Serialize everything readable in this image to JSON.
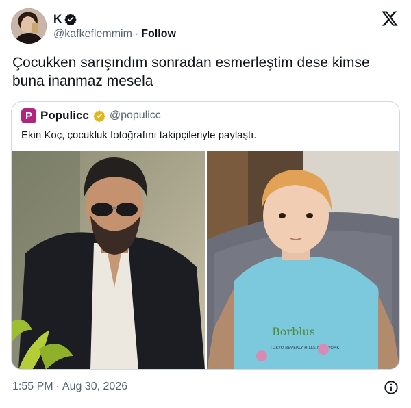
{
  "author": {
    "display_name": "K",
    "handle": "@kafkeflemmim",
    "separator": "·",
    "follow_label": "Follow",
    "verified_icon": "verified-badge-icon"
  },
  "tweet": {
    "line1": "Çocukken sarışındım sonradan esmerleştim dese kimse",
    "line2": "buna inanmaz mesela"
  },
  "quote": {
    "avatar_letter": "P",
    "display_name": "Populicc",
    "handle": "@populicc",
    "text": "Ekin Koç, çocukluk fotoğrafını takipçileriyle paylaştı.",
    "verified_icon": "gold-verified-badge-icon",
    "brand_color": "#b0257f"
  },
  "photos": {
    "left_alt": "man-with-sunglasses-photo",
    "right_alt": "child-photo",
    "shirt_text_1": "Borblus",
    "shirt_text_2": "TOKYO BEVERLY HILLS NEW YORK"
  },
  "footer": {
    "time": "1:55 PM",
    "separator": "·",
    "date": "Aug 30, 2026",
    "info_icon": "info-icon"
  }
}
